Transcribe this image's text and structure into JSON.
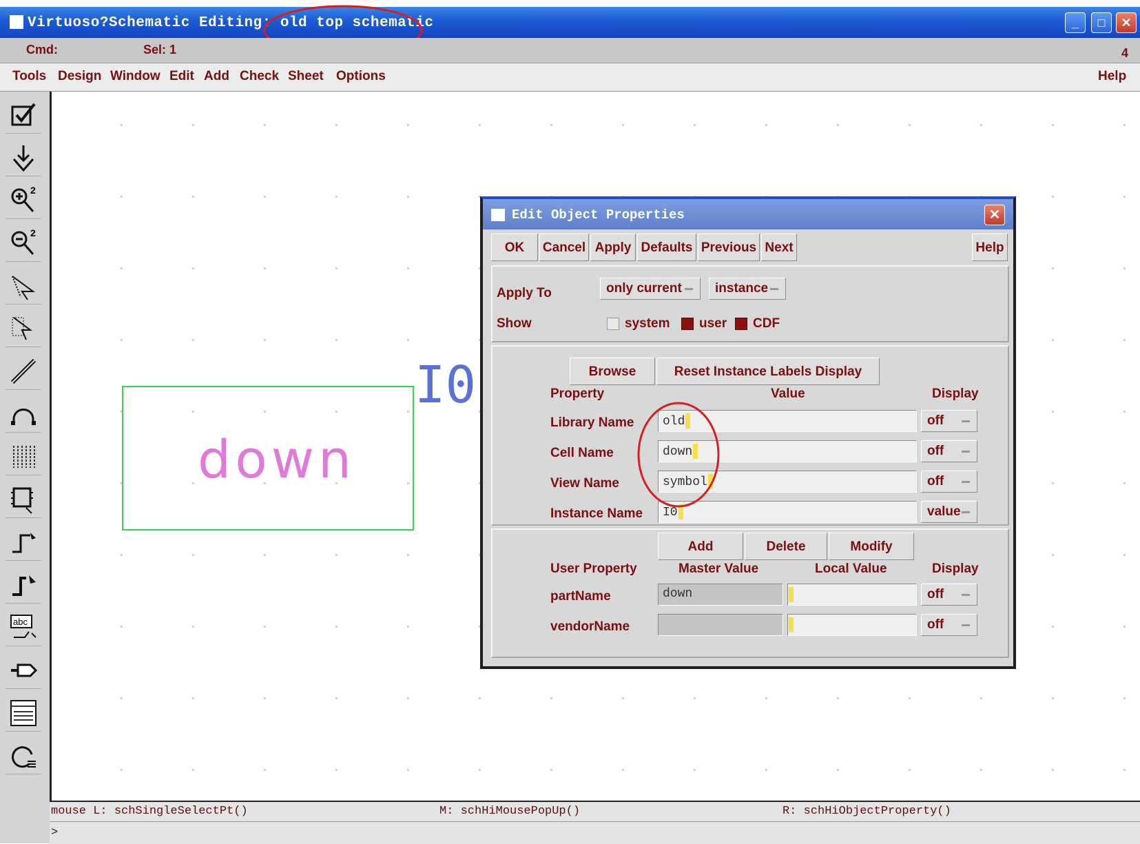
{
  "window": {
    "title": "Virtuoso?Schematic Editing: old top schematic",
    "minimize": "_",
    "maximize": "□",
    "close": "✕"
  },
  "status": {
    "cmd_label": "Cmd:",
    "sel_label": "Sel: 1",
    "right_number": "4"
  },
  "menu": {
    "items": [
      "Tools",
      "Design",
      "Window",
      "Edit",
      "Add",
      "Check",
      "Sheet",
      "Options"
    ],
    "help": "Help"
  },
  "toolbar": {
    "icons": [
      "check-icon",
      "save-icon",
      "zoom-in-icon",
      "zoom-out-icon",
      "stretch-icon",
      "copy-icon",
      "wire-icon",
      "undo-icon",
      "instance-icon",
      "property-icon",
      "wire-narrow-icon",
      "wire-wide-icon",
      "label-icon",
      "pin-icon",
      "sheet-icon",
      "repeat-icon"
    ]
  },
  "canvas": {
    "symbol_text": "down",
    "instance_label": "I0"
  },
  "bottom": {
    "mouse_l": "mouse L: schSingleSelectPt()",
    "mouse_m": "M: schHiMousePopUp()",
    "mouse_r": "R: schHiObjectProperty()",
    "prompt": ">"
  },
  "dialog": {
    "title": "Edit Object Properties",
    "buttons": {
      "ok": "OK",
      "cancel": "Cancel",
      "apply": "Apply",
      "defaults": "Defaults",
      "previous": "Previous",
      "next": "Next",
      "help": "Help"
    },
    "apply_to": {
      "label": "Apply To",
      "scope": "only current",
      "type": "instance"
    },
    "show": {
      "label": "Show",
      "system": "system",
      "system_checked": false,
      "user": "user",
      "user_checked": true,
      "cdf": "CDF",
      "cdf_checked": true
    },
    "browse": "Browse",
    "reset": "Reset Instance Labels Display",
    "headers": {
      "property": "Property",
      "value": "Value",
      "display": "Display"
    },
    "props": [
      {
        "label": "Library Name",
        "value": "old",
        "display": "off"
      },
      {
        "label": "Cell Name",
        "value": "down",
        "display": "off"
      },
      {
        "label": "View Name",
        "value": "symbol",
        "display": "off"
      },
      {
        "label": "Instance Name",
        "value": "I0",
        "display": "value"
      }
    ],
    "user_buttons": {
      "add": "Add",
      "delete": "Delete",
      "modify": "Modify"
    },
    "user_headers": {
      "property": "User Property",
      "master": "Master Value",
      "local": "Local Value",
      "display": "Display"
    },
    "user_props": [
      {
        "label": "partName",
        "master": "down",
        "local": "",
        "display": "off"
      },
      {
        "label": "vendorName",
        "master": "",
        "local": "",
        "display": "off"
      }
    ]
  }
}
